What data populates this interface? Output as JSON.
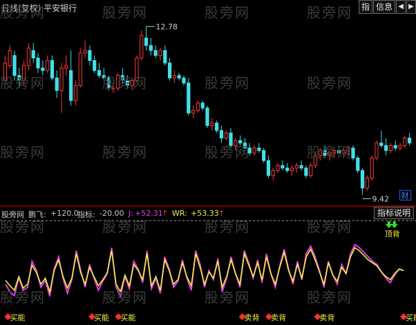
{
  "header": {
    "title": "日线(复权)  平安银行",
    "buttons": [
      "指",
      "信息"
    ],
    "arrow_left": "◀",
    "arrow_right": "▶"
  },
  "watermark": "股旁网",
  "price_chart": {
    "high_label": "12.78",
    "low_label": "9.42",
    "badge": "财",
    "colors": {
      "up": "#ff3a3a",
      "down": "#40e0e8",
      "grid": "#7a0000"
    },
    "candles": [
      [
        11.7,
        12.2,
        11.6,
        12.05
      ],
      [
        12.0,
        12.4,
        11.95,
        12.3
      ],
      [
        12.2,
        12.3,
        11.7,
        11.8
      ],
      [
        11.8,
        11.95,
        11.55,
        11.7
      ],
      [
        11.7,
        12.1,
        11.6,
        12.0
      ],
      [
        12.0,
        12.45,
        11.9,
        12.35
      ],
      [
        12.3,
        12.45,
        12.05,
        12.15
      ],
      [
        12.15,
        12.25,
        11.85,
        11.95
      ],
      [
        11.95,
        12.1,
        11.8,
        11.9
      ],
      [
        11.9,
        12.2,
        11.85,
        12.1
      ],
      [
        12.1,
        12.2,
        11.7,
        11.75
      ],
      [
        11.75,
        11.9,
        11.35,
        11.5
      ],
      [
        11.5,
        12.05,
        11.05,
        11.95
      ],
      [
        11.95,
        12.2,
        11.8,
        12.0
      ],
      [
        11.9,
        12.3,
        11.2,
        11.3
      ],
      [
        11.3,
        11.7,
        11.2,
        11.6
      ],
      [
        11.6,
        12.35,
        11.55,
        12.25
      ],
      [
        12.25,
        12.5,
        12.15,
        12.3
      ],
      [
        12.3,
        12.4,
        12.0,
        12.1
      ],
      [
        12.1,
        12.2,
        11.85,
        11.9
      ],
      [
        11.9,
        12.05,
        11.75,
        11.8
      ],
      [
        11.8,
        11.95,
        11.7,
        11.75
      ],
      [
        11.75,
        11.8,
        11.5,
        11.55
      ],
      [
        11.55,
        11.65,
        11.45,
        11.55
      ],
      [
        11.55,
        11.85,
        11.5,
        11.8
      ],
      [
        11.8,
        11.95,
        11.65,
        11.7
      ],
      [
        11.7,
        11.8,
        11.55,
        11.6
      ],
      [
        11.6,
        11.75,
        11.5,
        11.7
      ],
      [
        11.7,
        12.2,
        11.65,
        12.15
      ],
      [
        12.15,
        12.7,
        12.1,
        12.6
      ],
      [
        12.55,
        12.78,
        12.3,
        12.4
      ],
      [
        12.4,
        12.55,
        12.2,
        12.3
      ],
      [
        12.3,
        12.4,
        12.15,
        12.2
      ],
      [
        12.2,
        12.35,
        12.1,
        12.3
      ],
      [
        12.3,
        12.4,
        12.0,
        12.05
      ],
      [
        12.05,
        12.15,
        11.7,
        11.75
      ],
      [
        11.75,
        11.9,
        11.65,
        11.8
      ],
      [
        11.8,
        11.85,
        11.7,
        11.75
      ],
      [
        11.75,
        11.8,
        11.6,
        11.65
      ],
      [
        11.65,
        11.75,
        11.0,
        11.05
      ],
      [
        11.05,
        11.2,
        10.95,
        11.1
      ],
      [
        11.1,
        11.3,
        11.05,
        11.25
      ],
      [
        11.25,
        11.3,
        11.1,
        11.15
      ],
      [
        11.15,
        11.2,
        10.75,
        10.8
      ],
      [
        10.8,
        10.95,
        10.7,
        10.85
      ],
      [
        10.85,
        10.9,
        10.65,
        10.7
      ],
      [
        10.7,
        10.8,
        10.45,
        10.55
      ],
      [
        10.55,
        10.7,
        10.5,
        10.65
      ],
      [
        10.65,
        10.75,
        10.35,
        10.4
      ],
      [
        10.4,
        10.55,
        10.3,
        10.5
      ],
      [
        10.5,
        10.6,
        10.4,
        10.45
      ],
      [
        10.45,
        10.55,
        10.3,
        10.35
      ],
      [
        10.35,
        10.45,
        10.2,
        10.25
      ],
      [
        10.25,
        10.4,
        10.2,
        10.35
      ],
      [
        10.35,
        10.45,
        10.25,
        10.3
      ],
      [
        10.3,
        10.35,
        10.05,
        10.1
      ],
      [
        10.1,
        10.2,
        9.75,
        9.8
      ],
      [
        9.8,
        9.95,
        9.7,
        9.9
      ],
      [
        9.9,
        10.05,
        9.85,
        10.0
      ],
      [
        10.0,
        10.1,
        9.9,
        9.95
      ],
      [
        9.95,
        10.05,
        9.85,
        9.9
      ],
      [
        9.9,
        10.0,
        9.8,
        9.95
      ],
      [
        9.95,
        10.05,
        9.85,
        10.0
      ],
      [
        10.0,
        10.1,
        9.9,
        9.95
      ],
      [
        9.95,
        10.0,
        9.75,
        9.8
      ],
      [
        9.8,
        10.05,
        9.75,
        10.0
      ],
      [
        10.0,
        10.25,
        9.95,
        10.2
      ],
      [
        10.2,
        10.35,
        10.1,
        10.3
      ],
      [
        10.3,
        10.4,
        10.15,
        10.2
      ],
      [
        10.2,
        10.3,
        10.1,
        10.25
      ],
      [
        10.25,
        10.35,
        10.15,
        10.3
      ],
      [
        10.3,
        10.4,
        10.2,
        10.25
      ],
      [
        10.25,
        10.35,
        10.15,
        10.3
      ],
      [
        10.3,
        10.4,
        10.2,
        10.35
      ],
      [
        10.35,
        10.4,
        10.1,
        10.15
      ],
      [
        10.15,
        10.2,
        9.85,
        9.9
      ],
      [
        9.9,
        9.95,
        9.42,
        9.55
      ],
      [
        9.55,
        9.8,
        9.5,
        9.75
      ],
      [
        9.75,
        10.2,
        9.7,
        10.15
      ],
      [
        10.15,
        10.5,
        10.1,
        10.45
      ],
      [
        10.45,
        10.7,
        10.35,
        10.4
      ],
      [
        10.4,
        10.55,
        10.2,
        10.3
      ],
      [
        10.3,
        10.45,
        10.25,
        10.4
      ],
      [
        10.4,
        10.5,
        10.3,
        10.35
      ],
      [
        10.35,
        10.45,
        10.3,
        10.4
      ],
      [
        10.4,
        10.6,
        10.35,
        10.55
      ],
      [
        10.55,
        10.65,
        10.4,
        10.45
      ]
    ]
  },
  "indicator": {
    "name": "股旁网",
    "items": [
      {
        "label": "鹏飞:",
        "value": "+120.0",
        "color": "#c8c8c8"
      },
      {
        "label": "指标:",
        "value": "-20.00",
        "color": "#c8c8c8"
      },
      {
        "label": "J:",
        "value": "+52.31",
        "color": "#e040e0"
      },
      {
        "label": "WR:",
        "value": "+53.33",
        "color": "#f0f040"
      }
    ],
    "up_arrow": "↑",
    "explain_button": "指标说明",
    "colors": {
      "j": "#e040e0",
      "wr": "#f0f040"
    },
    "wr_values": [
      35,
      28,
      22,
      40,
      25,
      30,
      55,
      45,
      30,
      38,
      20,
      48,
      62,
      40,
      25,
      38,
      70,
      45,
      30,
      52,
      40,
      28,
      36,
      45,
      74,
      30,
      20,
      42,
      28,
      56,
      48,
      36,
      70,
      28,
      40,
      22,
      62,
      48,
      30,
      36,
      58,
      40,
      28,
      70,
      52,
      30,
      46,
      38,
      60,
      26,
      40,
      62,
      44,
      30,
      70,
      55,
      40,
      58,
      36,
      66,
      44,
      30,
      52,
      72,
      48,
      34,
      56,
      38,
      66,
      76,
      62,
      46,
      30,
      58,
      42,
      34,
      52,
      44,
      66,
      78,
      74,
      68,
      62,
      58,
      54,
      46,
      40,
      36,
      44,
      50,
      48
    ],
    "j_values": [
      30,
      20,
      15,
      38,
      22,
      26,
      60,
      48,
      26,
      35,
      14,
      50,
      66,
      38,
      18,
      36,
      74,
      48,
      26,
      56,
      38,
      22,
      34,
      44,
      78,
      26,
      14,
      40,
      24,
      60,
      50,
      32,
      74,
      24,
      38,
      18,
      66,
      50,
      26,
      34,
      62,
      38,
      22,
      74,
      56,
      26,
      48,
      36,
      64,
      20,
      38,
      66,
      44,
      26,
      74,
      58,
      38,
      62,
      32,
      70,
      44,
      26,
      54,
      76,
      50,
      30,
      60,
      36,
      70,
      80,
      66,
      48,
      26,
      60,
      42,
      30,
      56,
      44,
      70,
      82,
      78,
      72,
      66,
      60,
      56,
      46,
      38,
      32,
      42,
      50,
      48
    ],
    "signals": [
      {
        "text": "买能",
        "index": 1
      },
      {
        "text": "买能",
        "index": 20
      },
      {
        "text": "买能",
        "index": 26
      },
      {
        "text": "卖背",
        "index": 54
      },
      {
        "text": "卖背",
        "index": 60
      },
      {
        "text": "卖背",
        "index": 71
      },
      {
        "text": "买能",
        "index": 92
      }
    ],
    "top_signal": {
      "text": "顶背",
      "index": 87
    }
  }
}
